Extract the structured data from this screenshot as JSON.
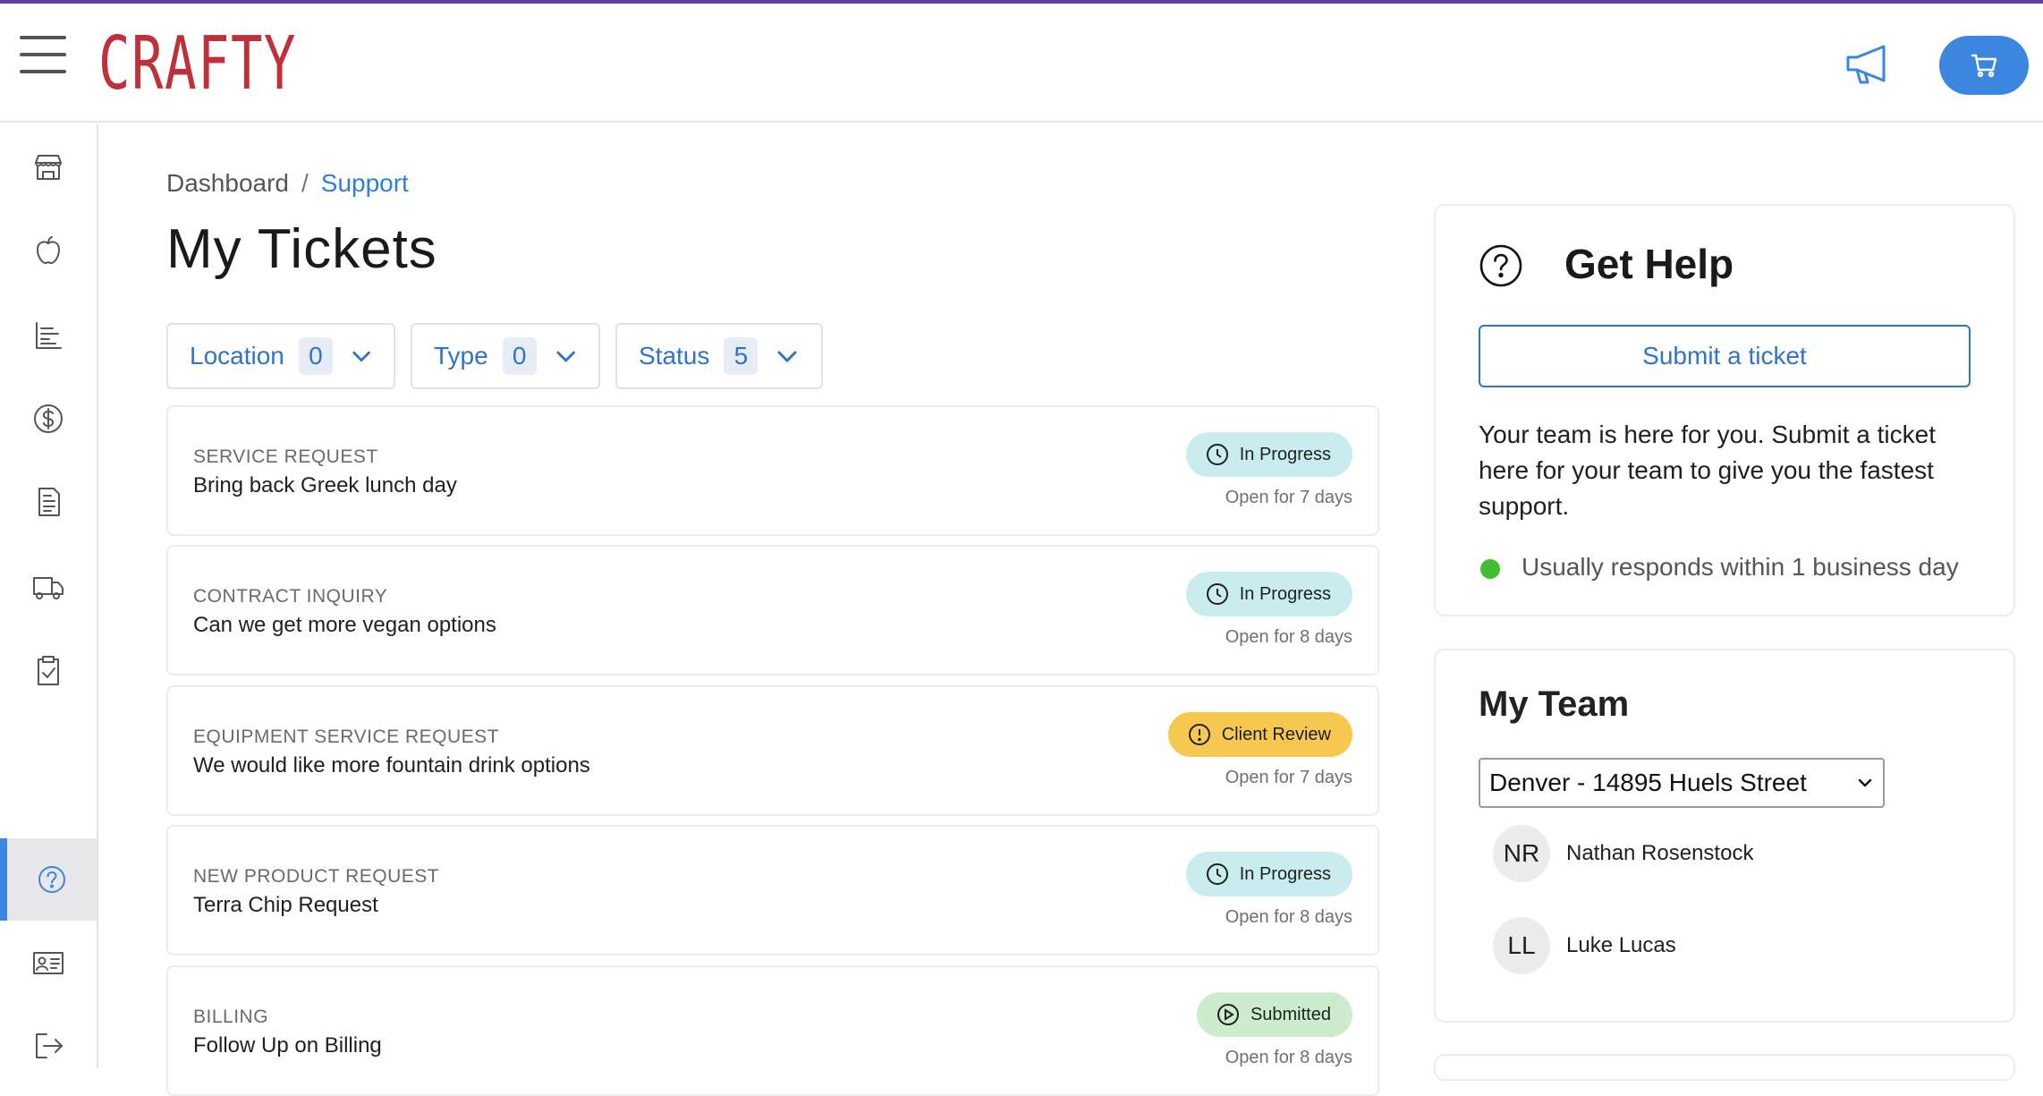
{
  "header": {
    "logo_text": "CRAFTY",
    "brand_color": "#c0303a",
    "accent_color": "#3d86e0"
  },
  "sidebar": {
    "items": [
      {
        "icon": "storefront-icon"
      },
      {
        "icon": "apple-icon"
      },
      {
        "icon": "bar-chart-icon"
      },
      {
        "icon": "dollar-icon"
      },
      {
        "icon": "invoice-icon"
      },
      {
        "icon": "truck-icon"
      },
      {
        "icon": "clipboard-check-icon"
      },
      {
        "icon": "help-icon",
        "active": true
      },
      {
        "icon": "id-card-icon"
      },
      {
        "icon": "logout-icon"
      }
    ]
  },
  "breadcrumb": {
    "parent": "Dashboard",
    "separator": "/",
    "current": "Support"
  },
  "page": {
    "title": "My Tickets"
  },
  "filters": [
    {
      "label": "Location",
      "count": "0"
    },
    {
      "label": "Type",
      "count": "0"
    },
    {
      "label": "Status",
      "count": "5"
    }
  ],
  "tickets": [
    {
      "type": "SERVICE REQUEST",
      "title": "Bring back Greek lunch day",
      "status": "In Progress",
      "status_kind": "progress",
      "age": "Open for 7 days"
    },
    {
      "type": "CONTRACT INQUIRY",
      "title": "Can we get more vegan options",
      "status": "In Progress",
      "status_kind": "progress",
      "age": "Open for 8 days"
    },
    {
      "type": "EQUIPMENT SERVICE REQUEST",
      "title": "We would like more fountain drink options",
      "status": "Client Review",
      "status_kind": "review",
      "age": "Open for 7 days"
    },
    {
      "type": "NEW PRODUCT REQUEST",
      "title": "Terra Chip Request",
      "status": "In Progress",
      "status_kind": "progress",
      "age": "Open for 8 days"
    },
    {
      "type": "BILLING",
      "title": "Follow Up on Billing",
      "status": "Submitted",
      "status_kind": "submitted",
      "age": "Open for 8 days"
    }
  ],
  "help": {
    "title": "Get Help",
    "button": "Submit a ticket",
    "text": "Your team is here for you. Submit a ticket here for your team to give you the fastest support.",
    "response_time": "Usually responds within 1 business day"
  },
  "team": {
    "title": "My Team",
    "selected_location": "Denver - 14895 Huels Street",
    "members": [
      {
        "initials": "NR",
        "name": "Nathan Rosenstock"
      },
      {
        "initials": "LL",
        "name": "Luke Lucas"
      }
    ]
  }
}
